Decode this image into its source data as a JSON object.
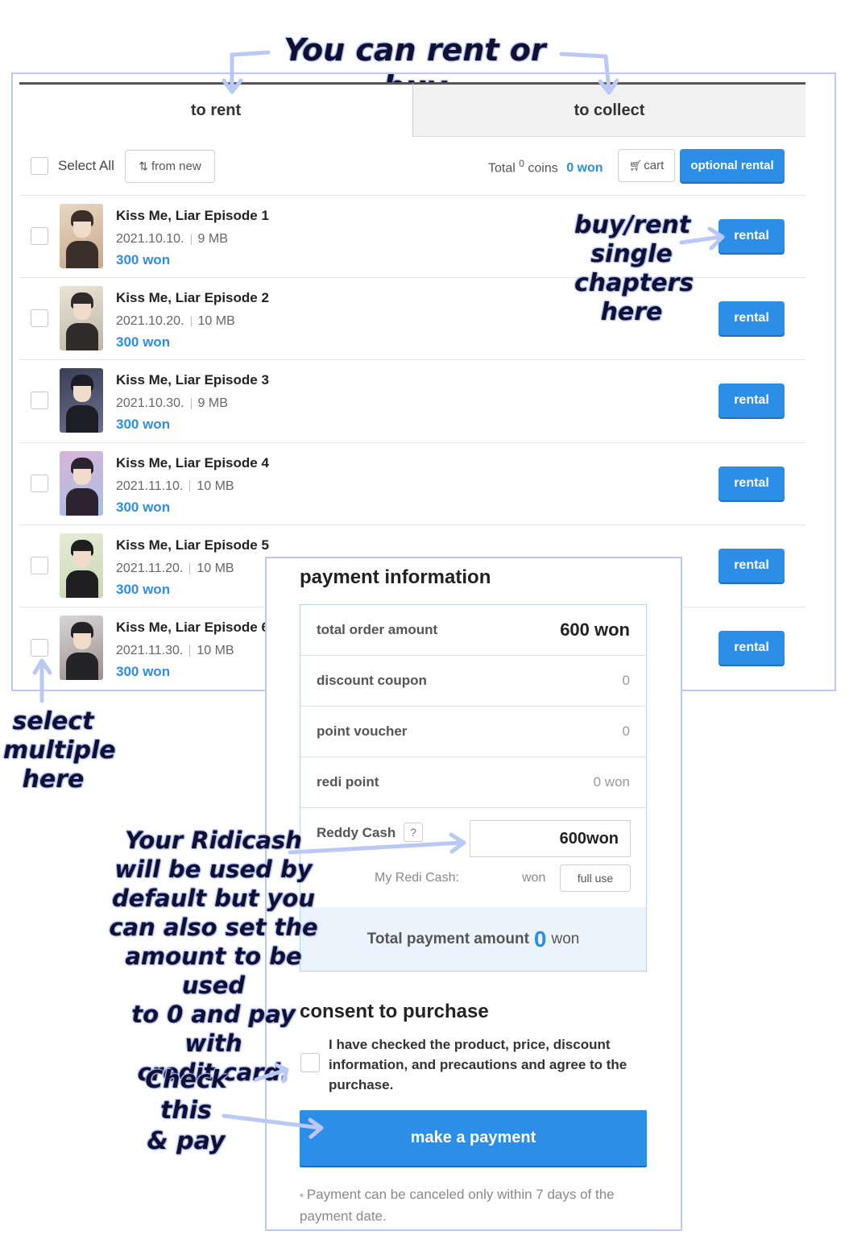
{
  "annotations": {
    "top": "You can rent or buy",
    "single": [
      "buy/rent",
      "single",
      "chapters",
      "here"
    ],
    "multiple": [
      "select",
      "multiple",
      "here"
    ],
    "ridicash": [
      "Your Ridicash",
      "will be used by",
      "default but you",
      "can also set the",
      "amount to be used",
      "to 0 and pay with",
      "credit card."
    ],
    "check": [
      "Check this",
      "& pay"
    ]
  },
  "tabs": {
    "rent": "to rent",
    "collect": "to collect"
  },
  "toolbar": {
    "select_all": "Select All",
    "sort_label": "from new",
    "total_label": "Total",
    "coins_value": "0",
    "coins_label": "coins",
    "won_value": "0 won",
    "cart_label": "cart",
    "optional_rental_label": "optional rental"
  },
  "episodes": [
    {
      "title": "Kiss Me, Liar Episode 1",
      "date": "2021.10.10.",
      "size": "9 MB",
      "price": "300 won",
      "button": "rental"
    },
    {
      "title": "Kiss Me, Liar Episode 2",
      "date": "2021.10.20.",
      "size": "10 MB",
      "price": "300 won",
      "button": "rental"
    },
    {
      "title": "Kiss Me, Liar Episode 3",
      "date": "2021.10.30.",
      "size": "9 MB",
      "price": "300 won",
      "button": "rental"
    },
    {
      "title": "Kiss Me, Liar Episode 4",
      "date": "2021.11.10.",
      "size": "10 MB",
      "price": "300 won",
      "button": "rental"
    },
    {
      "title": "Kiss Me, Liar Episode 5",
      "date": "2021.11.20.",
      "size": "10 MB",
      "price": "300 won",
      "button": "rental"
    },
    {
      "title": "Kiss Me, Liar Episode 6",
      "date": "2021.11.30.",
      "size": "10 MB",
      "price": "300 won",
      "button": "rental"
    }
  ],
  "payment": {
    "title": "payment information",
    "total_order_label": "total order amount",
    "total_order_value": "600 won",
    "discount_coupon_label": "discount coupon",
    "discount_coupon_value": "0",
    "point_voucher_label": "point voucher",
    "point_voucher_value": "0",
    "redi_point_label": "redi point",
    "redi_point_value": "0 won",
    "reddy_cash_label": "Reddy Cash",
    "help_label": "?",
    "reddy_cash_input_value": "600won",
    "my_redi_cash_label": "My Redi Cash:",
    "my_redi_cash_value": "won",
    "full_use_label": "full use",
    "total_payment_label": "Total payment amount",
    "total_payment_value": "0",
    "total_payment_unit": "won"
  },
  "consent": {
    "title": "consent to purchase",
    "text": "I have checked the product, price, discount information, and precautions and agree to the purchase.",
    "pay_button": "make a payment",
    "note": "Payment can be canceled only within 7 days of the payment date."
  },
  "colors": {
    "accent": "#2c8ee6",
    "annotation_outline": "#b9c8f5"
  }
}
